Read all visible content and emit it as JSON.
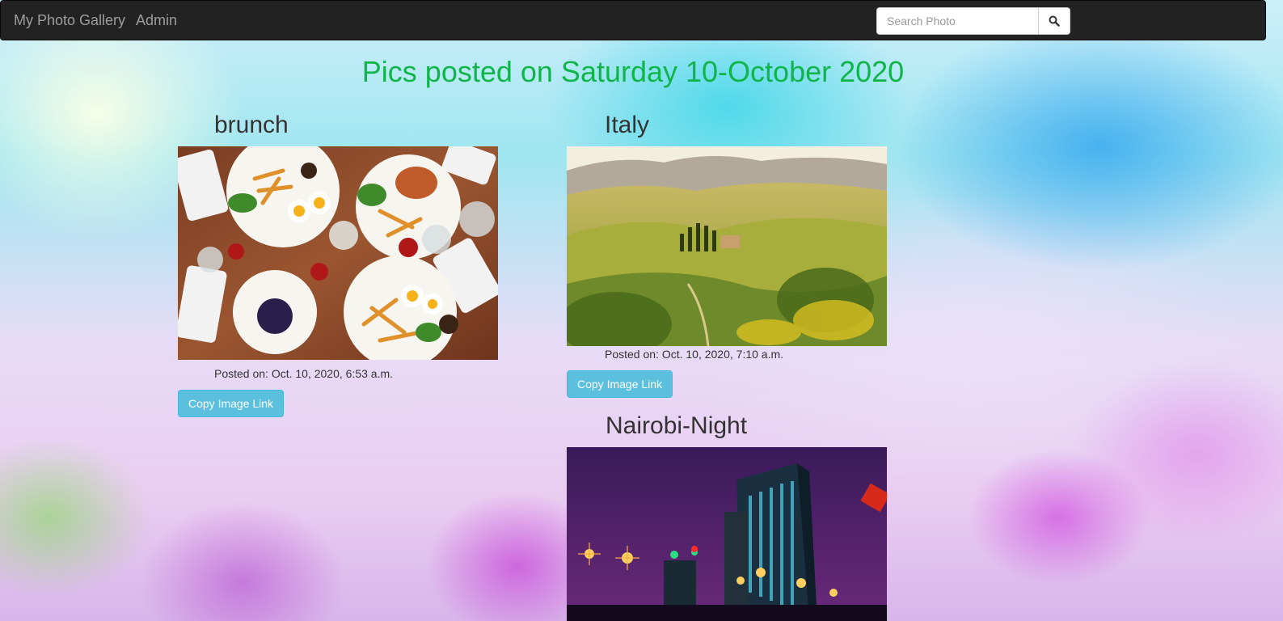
{
  "nav": {
    "brand": "My Photo Gallery",
    "admin": "Admin",
    "search_placeholder": "Search Photo",
    "search_icon": "search-icon"
  },
  "page": {
    "title": "Pics posted on Saturday 10-October 2020"
  },
  "photos": [
    {
      "title": "brunch",
      "posted": "Posted on: Oct. 10, 2020, 6:53 a.m.",
      "button": "Copy Image Link"
    },
    {
      "title": "Italy",
      "posted": "Posted on: Oct. 10, 2020, 7:10 a.m.",
      "button": "Copy Image Link"
    },
    {
      "title": "Nairobi-Night"
    }
  ],
  "colors": {
    "title": "#10b54a",
    "navbar": "#222222",
    "button": "#5bc0de"
  }
}
